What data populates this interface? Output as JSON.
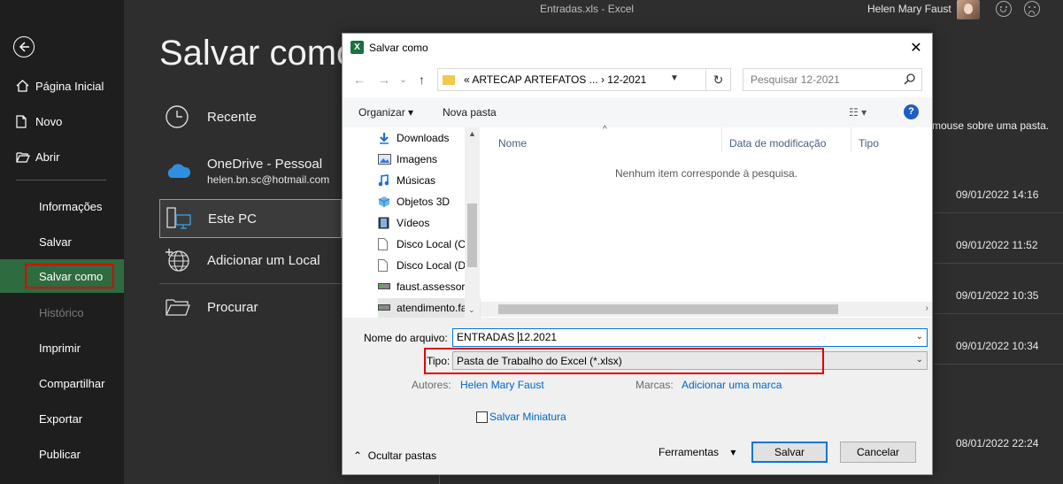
{
  "window": {
    "doc_title": "Entradas.xls  -  Excel",
    "user_name": "Helen Mary Faust"
  },
  "nav": {
    "items": [
      {
        "label": "Página Inicial"
      },
      {
        "label": "Novo"
      },
      {
        "label": "Abrir"
      },
      {
        "label": "Informações"
      },
      {
        "label": "Salvar"
      },
      {
        "label": "Salvar como"
      },
      {
        "label": "Histórico"
      },
      {
        "label": "Imprimir"
      },
      {
        "label": "Compartilhar"
      },
      {
        "label": "Exportar"
      },
      {
        "label": "Publicar"
      }
    ]
  },
  "main": {
    "title": "Salvar como",
    "locations": [
      {
        "label": "Recente",
        "icon": "clock-icon"
      },
      {
        "label": "OneDrive - Pessoal",
        "sub": "helen.bn.sc@hotmail.com",
        "icon": "cloud-icon"
      },
      {
        "label": "Este PC",
        "icon": "pc-icon"
      },
      {
        "label": "Adicionar um Local",
        "icon": "globe-plus-icon"
      },
      {
        "label": "Procurar",
        "icon": "folder-icon"
      }
    ],
    "hint": "mouse sobre uma pasta.",
    "recent_dates": [
      "09/01/2022 14:16",
      "09/01/2022 11:52",
      "09/01/2022 10:35",
      "09/01/2022 10:34",
      "08/01/2022 22:24"
    ]
  },
  "dialog": {
    "title": "Salvar como",
    "address_crumbs": "«   ARTECAP ARTEFATOS ...  ›   12-2021",
    "search_placeholder": "Pesquisar 12-2021",
    "toolbar": {
      "organize": "Organizar ▾",
      "new_folder": "Nova pasta"
    },
    "tree": [
      {
        "label": "Downloads"
      },
      {
        "label": "Imagens"
      },
      {
        "label": "Músicas"
      },
      {
        "label": "Objetos 3D"
      },
      {
        "label": "Vídeos"
      },
      {
        "label": "Disco Local (C:"
      },
      {
        "label": "Disco Local (D:"
      },
      {
        "label": "faust.assessoria"
      },
      {
        "label": "atendimento.fa"
      }
    ],
    "columns": {
      "name": "Nome",
      "modified": "Data de modificação",
      "type": "Tipo"
    },
    "empty_message": "Nenhum item corresponde à pesquisa.",
    "filename_label": "Nome do arquivo:",
    "filename_before_cursor": "ENTRADAS ",
    "filename_after_cursor": "12.2021",
    "type_label": "Tipo:",
    "type_value": "Pasta de Trabalho do Excel (*.xlsx)",
    "authors_label": "Autores:",
    "authors_value": "Helen Mary Faust",
    "tags_label": "Marcas:",
    "tags_value": "Adicionar uma marca",
    "thumbnail_label": "Salvar Miniatura",
    "hide_folders": "Ocultar pastas",
    "tools": "Ferramentas",
    "save": "Salvar",
    "cancel": "Cancelar"
  },
  "colors": {
    "active_nav": "#2e6b3f",
    "highlight_box": "#e00000",
    "accent_blue": "#0078d7"
  }
}
